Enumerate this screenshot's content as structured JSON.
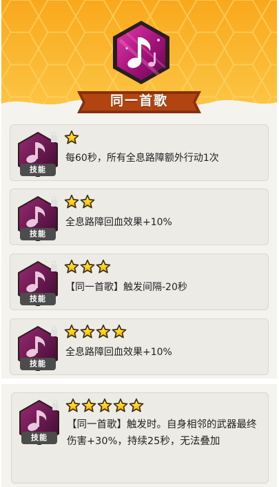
{
  "skill": {
    "title": "同一首歌",
    "tag_label": "技能",
    "icon": "music-note-icon"
  },
  "colors": {
    "honeycomb_bg": "#f7b521",
    "ribbon": "#8a2f0c",
    "emblem_magenta": "#c0208f",
    "card_bg": "#ecebe6",
    "star_gold": "#ffcc00"
  },
  "upgrades": [
    {
      "stars": 1,
      "description": "每60秒，所有全息路障额外行动1次"
    },
    {
      "stars": 2,
      "description": "全息路障回血效果+10%"
    },
    {
      "stars": 3,
      "description": "【同一首歌】触发间隔-20秒"
    },
    {
      "stars": 4,
      "description": "全息路障回血效果+10%"
    },
    {
      "stars": 5,
      "description": "【同一首歌】触发时。自身相邻的武器最终伤害+30%，持续25秒，无法叠加"
    }
  ]
}
